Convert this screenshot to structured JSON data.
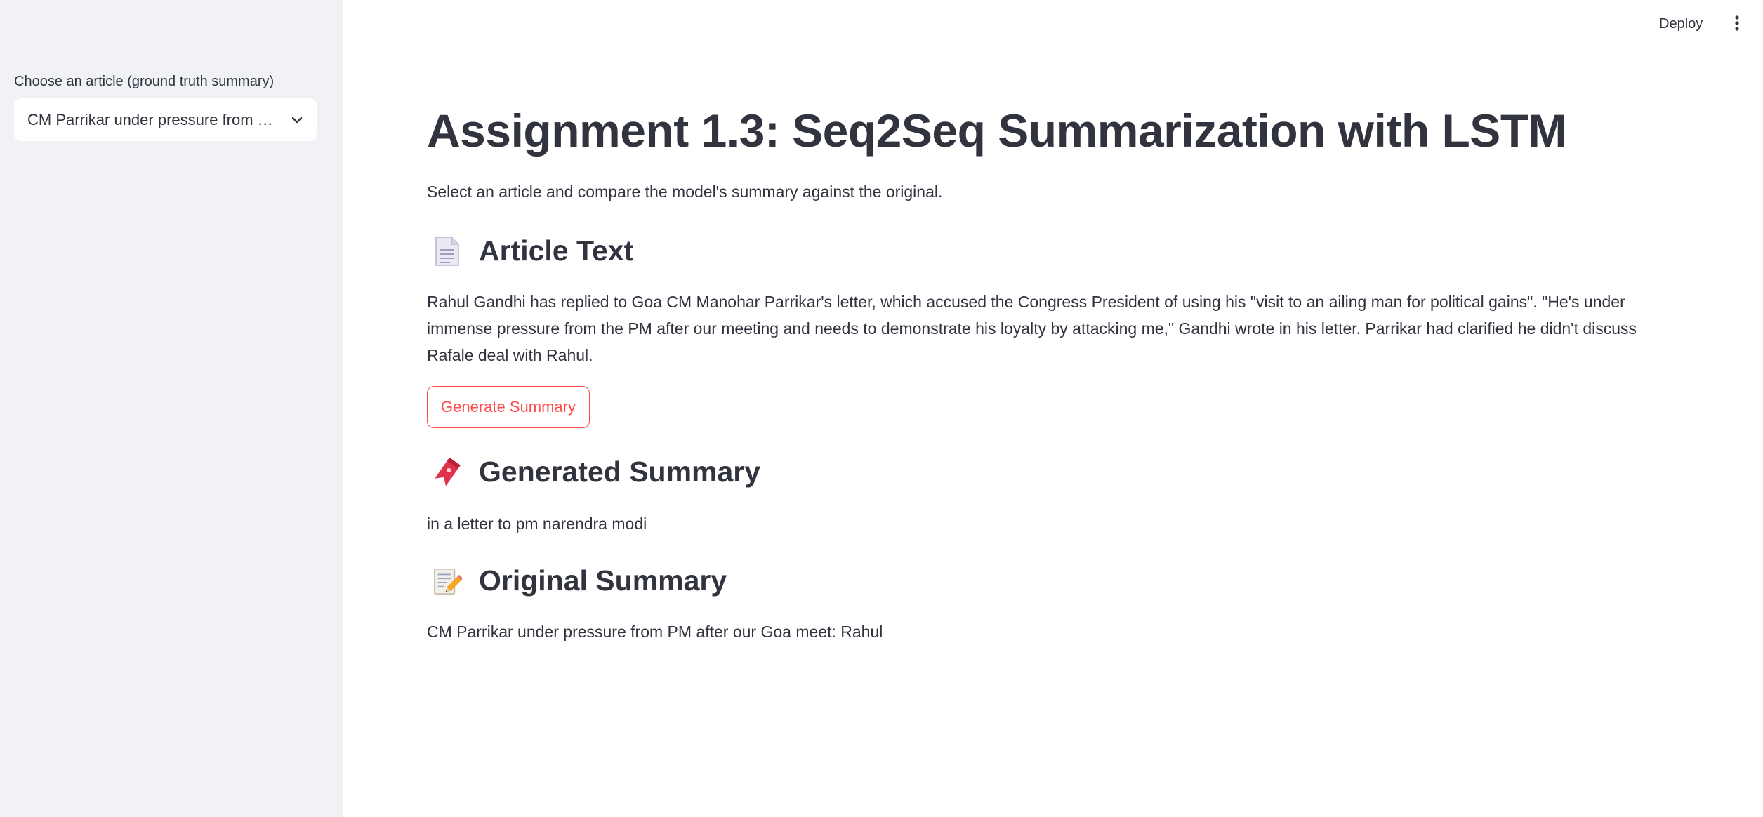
{
  "header": {
    "deploy_label": "Deploy"
  },
  "sidebar": {
    "select_label": "Choose an article (ground truth summary)",
    "select_value": "CM Parrikar under pressure from PM after our Goa meet: Rahul"
  },
  "main": {
    "title": "Assignment 1.3: Seq2Seq Summarization with LSTM",
    "subtitle": "Select an article and compare the model's summary against the original.",
    "article_heading": "Article Text",
    "article_text": "Rahul Gandhi has replied to Goa CM Manohar Parrikar's letter, which accused the Congress President of using his \"visit to an ailing man for political gains\". \"He's under immense pressure from the PM after our meeting and needs to demonstrate his loyalty by attacking me,\" Gandhi wrote in his letter. Parrikar had clarified he didn't discuss Rafale deal with Rahul.",
    "generate_button_label": "Generate Summary",
    "generated_heading": "Generated Summary",
    "generated_text": "in a letter to pm narendra modi",
    "original_heading": "Original Summary",
    "original_text": "CM Parrikar under pressure from PM after our Goa meet: Rahul"
  },
  "icons": {
    "article": "page-facing-up-icon",
    "generated": "bookmark-icon",
    "original": "memo-icon",
    "select_caret": "chevron-down-icon",
    "menu": "kebab-menu-icon"
  },
  "colors": {
    "sidebar_bg": "#f0f2f6",
    "text": "#31333f",
    "accent": "#ff4b4b"
  }
}
